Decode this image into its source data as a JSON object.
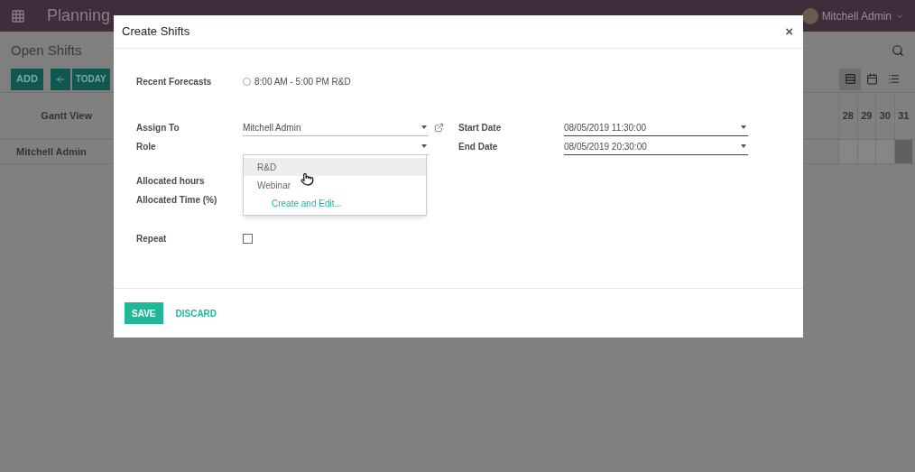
{
  "navbar": {
    "app_title": "Planning",
    "user": "Mitchell Admin"
  },
  "control_panel": {
    "title": "Open Shifts",
    "add_button": "ADD",
    "today_button": "TODAY",
    "views": [
      {
        "kind": "gantt",
        "selected": true
      },
      {
        "kind": "calendar",
        "selected": false
      },
      {
        "kind": "list",
        "selected": false
      }
    ]
  },
  "gantt": {
    "corner": "Gantt View",
    "days": [
      {
        "label": "28",
        "highlighted": false
      },
      {
        "label": "29",
        "highlighted": false
      },
      {
        "label": "30",
        "highlighted": false
      },
      {
        "label": "31",
        "highlighted": true
      }
    ],
    "rows": [
      {
        "name": "Mitchell Admin"
      }
    ]
  },
  "modal": {
    "title": "Create Shifts",
    "close": "×",
    "recent_forecasts": {
      "label": "Recent Forecasts",
      "options": [
        {
          "label": "8:00 AM - 5:00 PM R&D",
          "selected": false
        }
      ]
    },
    "assign_to": {
      "label": "Assign To",
      "value": "Mitchell Admin"
    },
    "role": {
      "label": "Role",
      "options": [
        {
          "label": "R&D",
          "selected": true
        },
        {
          "label": "Webinar",
          "selected": false
        }
      ],
      "create_link": "Create and Edit..."
    },
    "allocated_hours": {
      "label": "Allocated hours"
    },
    "allocated_time": {
      "label": "Allocated Time (%)"
    },
    "repeat": {
      "label": "Repeat",
      "checked": false
    },
    "start_date": {
      "label": "Start Date",
      "value": "08/05/2019 11:30:00"
    },
    "end_date": {
      "label": "End Date",
      "value": "08/05/2019 20:30:00"
    },
    "save": "SAVE",
    "discard": "DISCARD"
  }
}
